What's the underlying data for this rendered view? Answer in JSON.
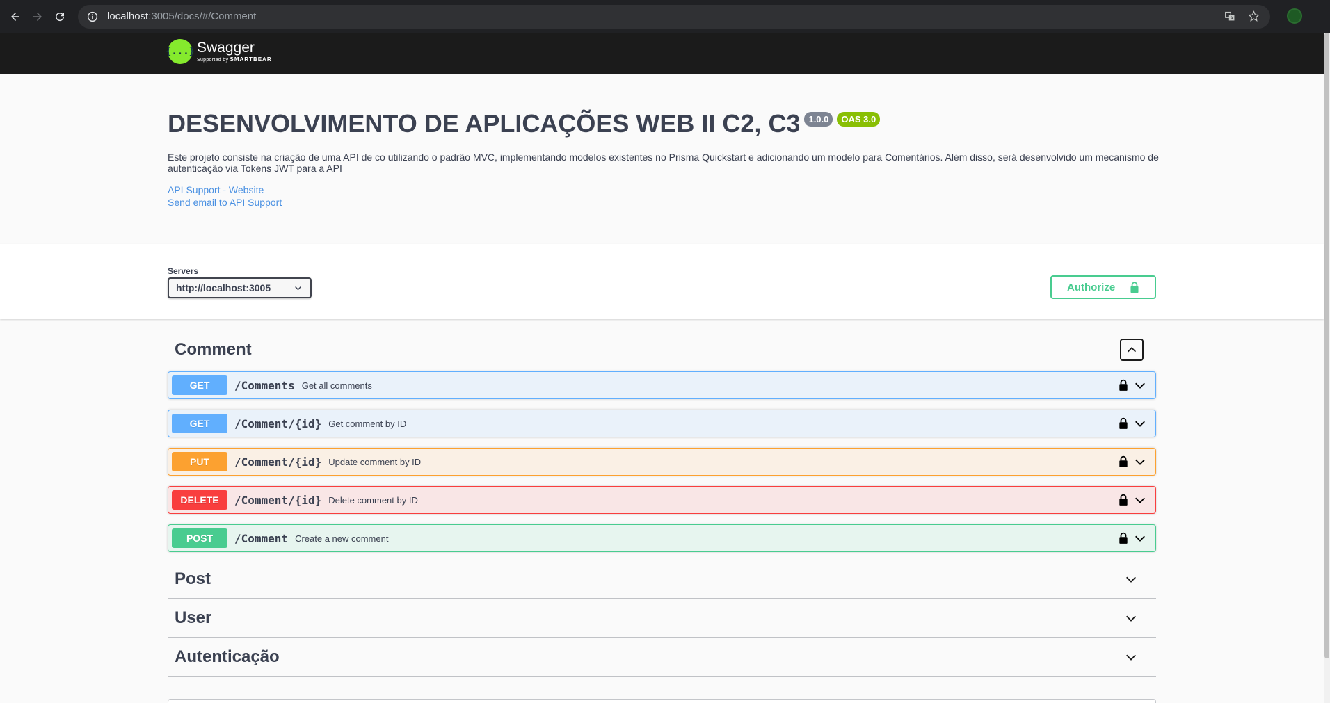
{
  "browser": {
    "url_host": "localhost",
    "url_rest": ":3005/docs/#/Comment"
  },
  "topbar": {
    "logo_icon": "{...}",
    "logo_name": "Swagger",
    "logo_sub_prefix": "Supported by ",
    "logo_sub_brand": "SMARTBEAR"
  },
  "info": {
    "title": "DESENVOLVIMENTO DE APLICAÇÕES WEB II C2, C3",
    "version": "1.0.0",
    "oas": "OAS 3.0",
    "description": "Este projeto consiste na criação de uma API de co utilizando o padrão MVC, implementando modelos existentes no Prisma Quickstart e adicionando um modelo para Comentários. Além disso, será desenvolvido um mecanismo de autenticação via Tokens JWT para a API",
    "links": {
      "website": "API Support - Website",
      "email": "Send email to API Support"
    }
  },
  "servers": {
    "label": "Servers",
    "selected": "http://localhost:3005",
    "authorize": "Authorize"
  },
  "tags": [
    {
      "name": "Comment",
      "expanded": true,
      "operations": [
        {
          "method": "GET",
          "path": "/Comments",
          "summary": "Get all comments"
        },
        {
          "method": "GET",
          "path": "/Comment/{id}",
          "summary": "Get comment by ID"
        },
        {
          "method": "PUT",
          "path": "/Comment/{id}",
          "summary": "Update comment by ID"
        },
        {
          "method": "DELETE",
          "path": "/Comment/{id}",
          "summary": "Delete comment by ID"
        },
        {
          "method": "POST",
          "path": "/Comment",
          "summary": "Create a new comment"
        }
      ]
    },
    {
      "name": "Post",
      "expanded": false
    },
    {
      "name": "User",
      "expanded": false
    },
    {
      "name": "Autenticação",
      "expanded": false
    }
  ],
  "colors": {
    "get": "#61affe",
    "put": "#fca130",
    "delete": "#f93e3e",
    "post": "#49cc90",
    "link": "#4990e2",
    "topbar": "#1b1b1b"
  },
  "icons": {
    "back": "arrow-left-icon",
    "forward": "arrow-right-icon",
    "reload": "reload-icon",
    "site_info": "info-icon",
    "translate": "translate-icon",
    "bookmark": "star-icon",
    "lock": "lock-icon",
    "chevron": "chevron-down-icon"
  }
}
